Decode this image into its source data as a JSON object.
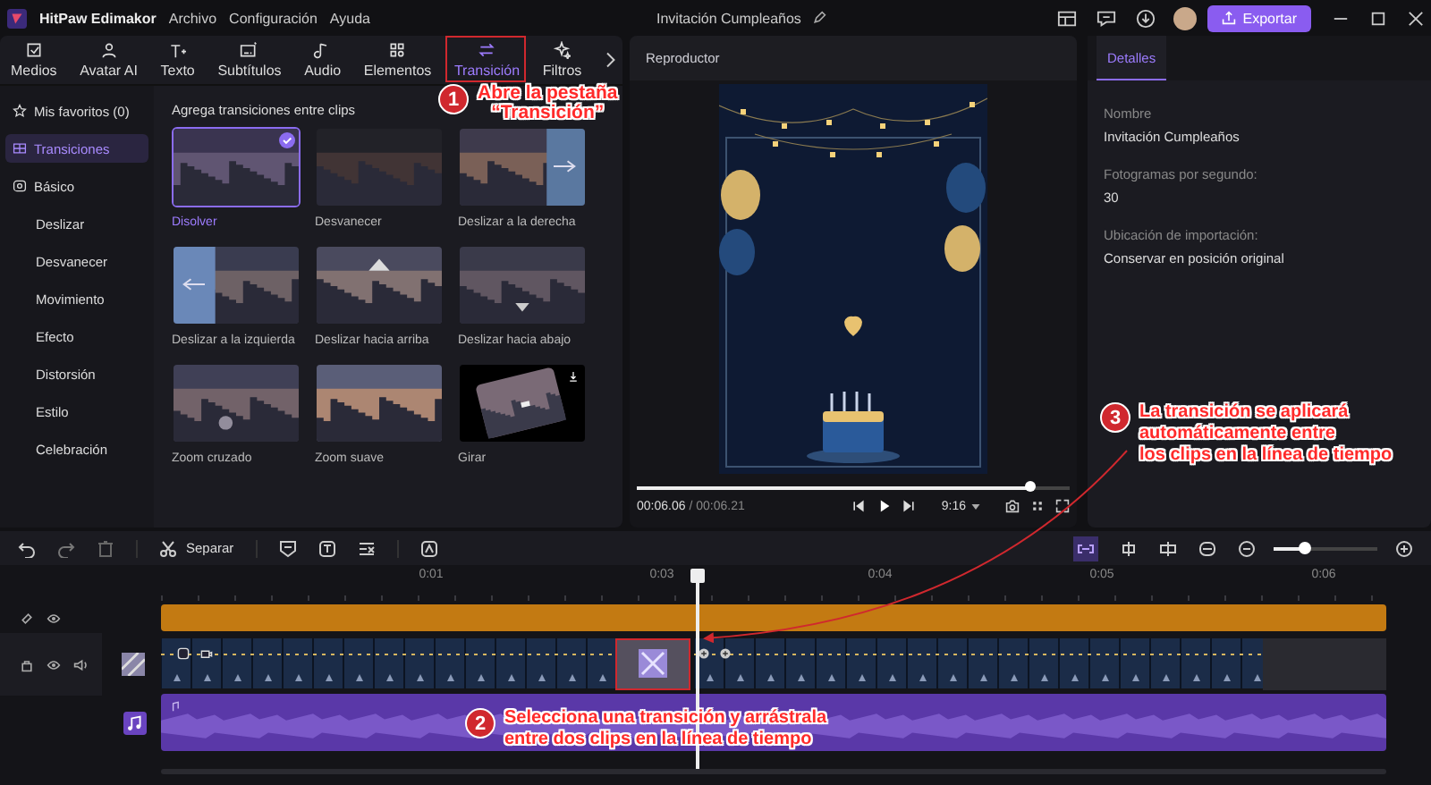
{
  "app": {
    "name": "HitPaw Edimakor",
    "menu": [
      "Archivo",
      "Configuración",
      "Ayuda"
    ]
  },
  "project": {
    "title": "Invitación Cumpleaños"
  },
  "export_button": "Exportar",
  "toolbar_tabs": [
    {
      "label": "Medios",
      "selected": false
    },
    {
      "label": "Avatar AI",
      "selected": false
    },
    {
      "label": "Texto",
      "selected": false
    },
    {
      "label": "Subtítulos",
      "selected": false
    },
    {
      "label": "Audio",
      "selected": false
    },
    {
      "label": "Elementos",
      "selected": false
    },
    {
      "label": "Transición",
      "selected": true
    },
    {
      "label": "Filtros",
      "selected": false
    }
  ],
  "sidebar": {
    "items": [
      {
        "label": "Mis favoritos (0)",
        "kind": "favorites",
        "selected": false
      },
      {
        "label": "Transiciones",
        "kind": "all",
        "selected": true
      },
      {
        "label": "Básico",
        "kind": "basic",
        "selected": false
      },
      {
        "label": "Deslizar",
        "kind": "category",
        "selected": false
      },
      {
        "label": "Desvanecer",
        "kind": "category",
        "selected": false
      },
      {
        "label": "Movimiento",
        "kind": "category",
        "selected": false
      },
      {
        "label": "Efecto",
        "kind": "category",
        "selected": false
      },
      {
        "label": "Distorsión",
        "kind": "category",
        "selected": false
      },
      {
        "label": "Estilo",
        "kind": "category",
        "selected": false
      },
      {
        "label": "Celebración",
        "kind": "category",
        "selected": false
      }
    ]
  },
  "library": {
    "heading": "Agrega transiciones entre clips",
    "items": [
      {
        "label": "Disolver",
        "selected": true,
        "downloadable": false
      },
      {
        "label": "Desvanecer",
        "selected": false,
        "downloadable": false
      },
      {
        "label": "Deslizar a la derecha",
        "selected": false,
        "downloadable": false
      },
      {
        "label": "Deslizar a la izquierda",
        "selected": false,
        "downloadable": false
      },
      {
        "label": "Deslizar hacia arriba",
        "selected": false,
        "downloadable": false
      },
      {
        "label": "Deslizar hacia abajo",
        "selected": false,
        "downloadable": false
      },
      {
        "label": "Zoom cruzado",
        "selected": false,
        "downloadable": false
      },
      {
        "label": "Zoom suave",
        "selected": false,
        "downloadable": false
      },
      {
        "label": "Girar",
        "selected": false,
        "downloadable": true
      }
    ]
  },
  "player": {
    "title": "Reproductor",
    "current_time": "00:06.06",
    "total_time": "/ 00:06.21",
    "level": 0.91,
    "aspect_ratio": "9:16"
  },
  "details": {
    "tab": "Detalles",
    "fields": [
      {
        "label": "Nombre",
        "value": "Invitación Cumpleaños"
      },
      {
        "label": "Fotogramas por segundo:",
        "value": "30"
      },
      {
        "label": "Ubicación de importación:",
        "value": "Conservar en posición original"
      }
    ]
  },
  "timeline": {
    "split_label": "Separar",
    "ruler": [
      "0:01",
      "0:03",
      "0:04",
      "0:05",
      "0:06"
    ],
    "zoom_slider": {
      "level": 0.3
    }
  },
  "annotations": [
    {
      "number": "1",
      "lines": [
        "Abre la pestaña",
        "“Transición”"
      ]
    },
    {
      "number": "2",
      "lines": [
        "Selecciona una transición y arrástrala",
        "entre dos clips en la línea de tiempo"
      ]
    },
    {
      "number": "3",
      "lines": [
        "La transición se aplicará",
        "automáticamente entre",
        "los clips en la línea de tiempo"
      ]
    }
  ]
}
